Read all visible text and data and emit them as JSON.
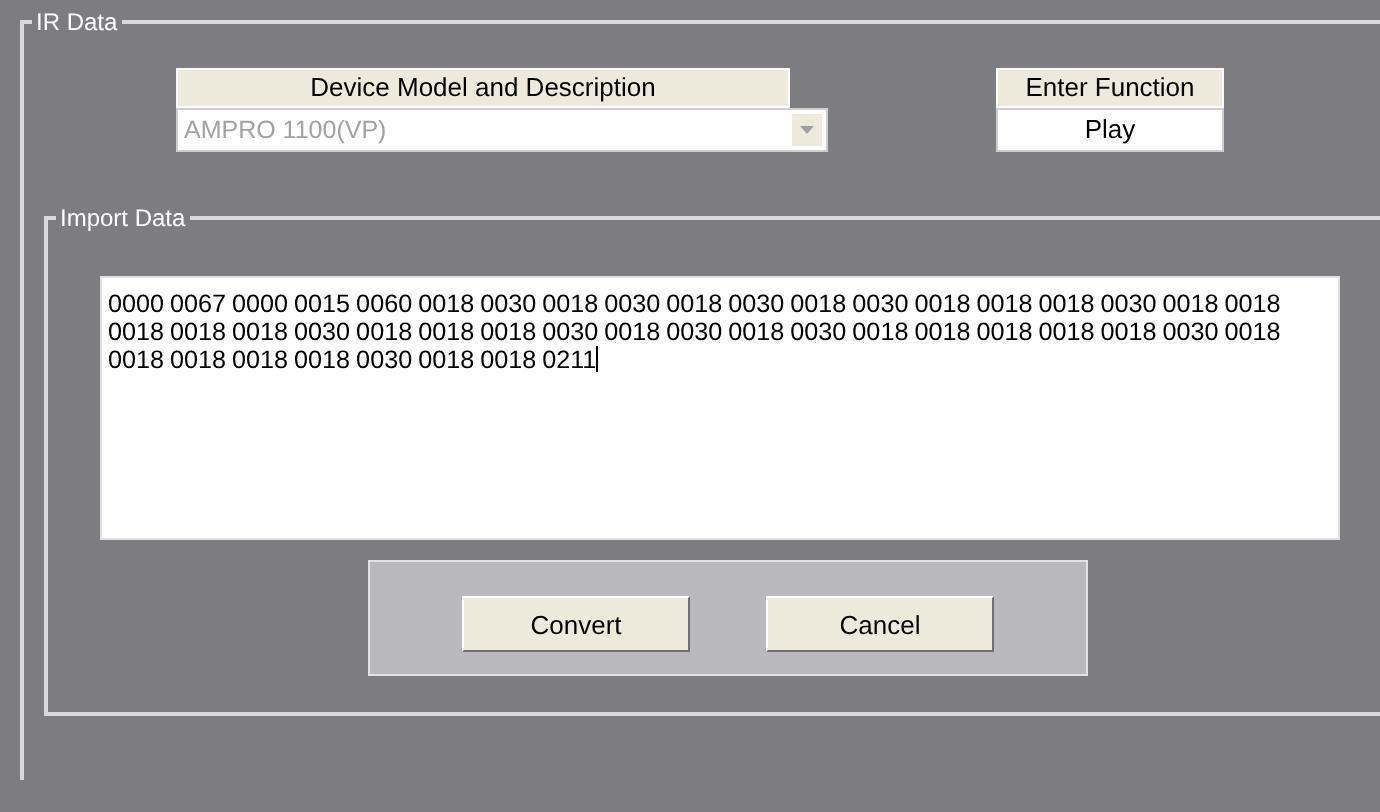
{
  "ir_group": {
    "title": "IR Data"
  },
  "device": {
    "header": "Device Model and Description",
    "value": "AMPRO 1100(VP)",
    "disabled": true
  },
  "function": {
    "header": "Enter Function",
    "value": "Play"
  },
  "import_group": {
    "title": "Import Data"
  },
  "import_text": "0000 0067 0000 0015 0060 0018 0030 0018 0030 0018 0030 0018 0030 0018 0018 0018 0030 0018 0018 0018 0018 0018 0030 0018 0018 0018 0030 0018 0030 0018 0030 0018 0018 0018 0018 0018 0030 0018 0018 0018 0018 0018 0030 0018 0018 0211",
  "buttons": [
    "Convert",
    "Cancel"
  ]
}
